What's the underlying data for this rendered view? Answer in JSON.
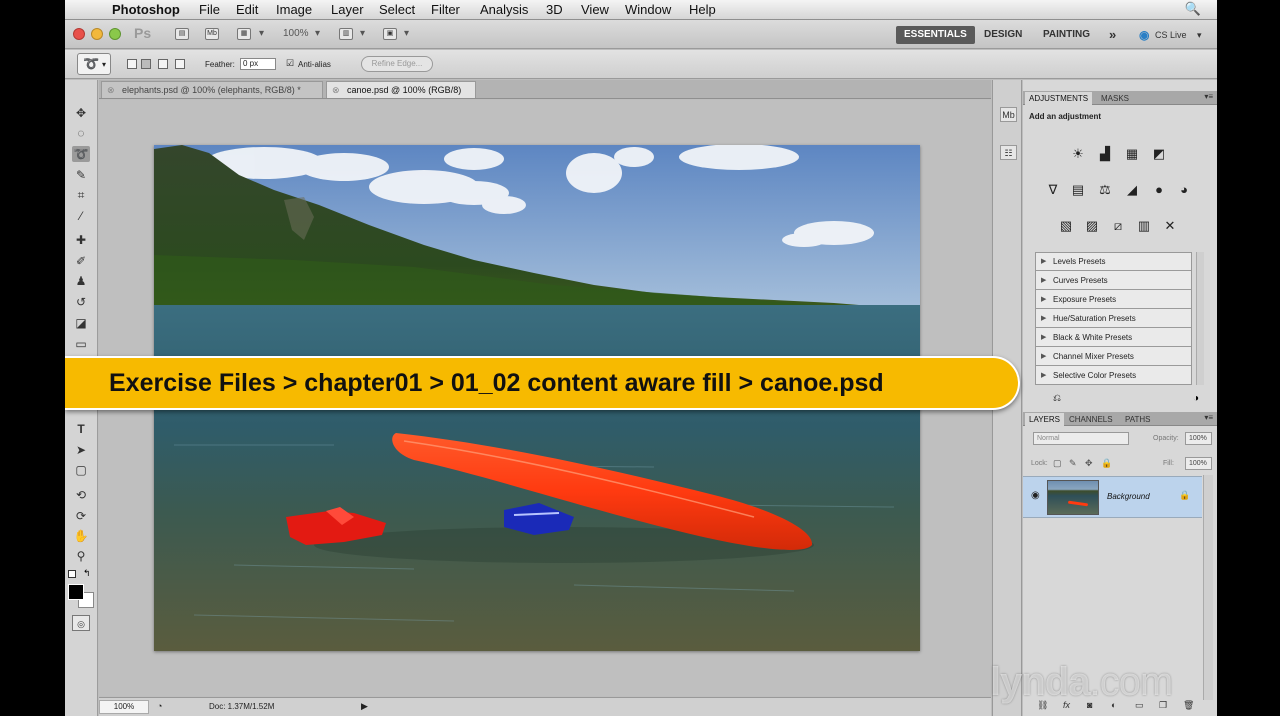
{
  "menubar": {
    "app": "Photoshop",
    "items": [
      "File",
      "Edit",
      "Image",
      "Layer",
      "Select",
      "Filter",
      "Analysis",
      "3D",
      "View",
      "Window",
      "Help"
    ]
  },
  "appbar": {
    "logo": "Ps",
    "zoom": "100%",
    "workspaces": [
      "ESSENTIALS",
      "DESIGN",
      "PAINTING"
    ],
    "more": "»",
    "cs_live": "CS Live"
  },
  "options": {
    "feather_label": "Feather:",
    "feather_value": "0 px",
    "anti_alias_label": "Anti-alias",
    "anti_alias_checked": true,
    "refine_edge": "Refine Edge..."
  },
  "tabs": [
    {
      "label": "elephants.psd @ 100% (elephants, RGB/8) *",
      "active": false
    },
    {
      "label": "canoe.psd @ 100% (RGB/8)",
      "active": true
    }
  ],
  "status": {
    "zoom": "100%",
    "doc": "Doc: 1.37M/1.52M"
  },
  "adjustments": {
    "tabs": [
      "ADJUSTMENTS",
      "MASKS"
    ],
    "hint": "Add an adjustment",
    "presets": [
      "Levels Presets",
      "Curves Presets",
      "Exposure Presets",
      "Hue/Saturation Presets",
      "Black & White Presets",
      "Channel Mixer Presets",
      "Selective Color Presets"
    ]
  },
  "layers": {
    "tabs": [
      "LAYERS",
      "CHANNELS",
      "PATHS"
    ],
    "blend_mode": "Normal",
    "opacity_label": "Opacity:",
    "opacity_value": "100%",
    "lock_label": "Lock:",
    "fill_label": "Fill:",
    "fill_value": "100%",
    "layer_name": "Background"
  },
  "banner": {
    "path": "Exercise Files > chapter01 > 01_02 content aware fill > canoe.psd"
  },
  "watermark": {
    "text_a": "lynda",
    "text_b": ".com"
  },
  "colors": {
    "banner": "#f7ba00",
    "canoe": "#ff3a10",
    "selected_layer": "#bcd3ec"
  }
}
